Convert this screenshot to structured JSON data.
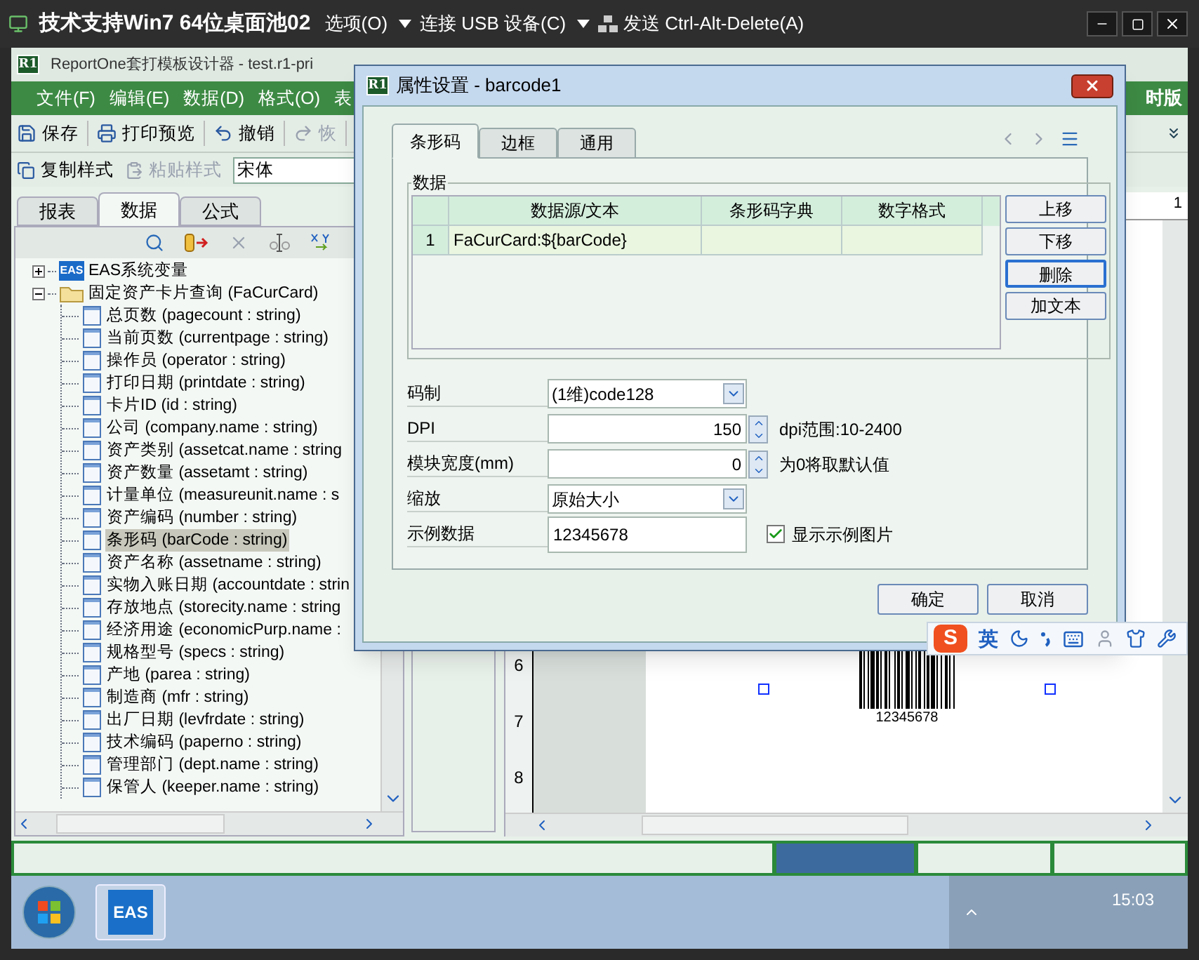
{
  "host_bar": {
    "title": "技术支持Win7 64位桌面池02",
    "menus": [
      {
        "label": "选项(O)",
        "kind": "menu"
      },
      {
        "label": "连接 USB 设备(C)",
        "kind": "menu"
      },
      {
        "label": "发送 Ctrl-Alt-Delete(A)",
        "kind": "action"
      }
    ]
  },
  "app_window": {
    "logo": "R1",
    "title": "ReportOne套打模板设计器 - test.r1-pri"
  },
  "menu_bar": {
    "items": [
      "文件(F)",
      "编辑(E)",
      "数据(D)",
      "格式(O)",
      "表"
    ],
    "right_text": "时版"
  },
  "toolbar": [
    {
      "label": "保存",
      "kind": "save",
      "disabled": false
    },
    {
      "label": "打印预览",
      "kind": "preview",
      "disabled": false
    },
    {
      "label": "撤销",
      "kind": "undo",
      "disabled": false
    },
    {
      "label": "恢",
      "kind": "redo",
      "disabled": true
    }
  ],
  "format_toolbar": {
    "buttons": [
      {
        "label": "复制样式",
        "disabled": false
      },
      {
        "label": "粘贴样式",
        "disabled": true
      }
    ],
    "font": "宋体"
  },
  "left_panel": {
    "tabs": [
      {
        "label": "报表",
        "selected": false
      },
      {
        "label": "数据",
        "selected": true
      },
      {
        "label": "公式",
        "selected": false
      }
    ],
    "tree": [
      {
        "label": "EAS系统变量",
        "logo": "EAS",
        "expanded": false,
        "selected": false
      },
      {
        "label": "固定资产卡片查询 (FaCurCard)",
        "expanded": true,
        "selected": false,
        "children": [
          {
            "label": "总页数 (pagecount : string)",
            "selected": false
          },
          {
            "label": "当前页数 (currentpage : string)",
            "selected": false
          },
          {
            "label": "操作员 (operator : string)",
            "selected": false
          },
          {
            "label": "打印日期 (printdate : string)",
            "selected": false
          },
          {
            "label": "卡片ID (id : string)",
            "selected": false
          },
          {
            "label": "公司 (company.name : string)",
            "selected": false
          },
          {
            "label": "资产类别 (assetcat.name : string",
            "selected": false
          },
          {
            "label": "资产数量 (assetamt : string)",
            "selected": false
          },
          {
            "label": "计量单位 (measureunit.name : s",
            "selected": false
          },
          {
            "label": "资产编码 (number : string)",
            "selected": false
          },
          {
            "label": "条形码 (barCode : string)",
            "selected": true
          },
          {
            "label": "资产名称 (assetname : string)",
            "selected": false
          },
          {
            "label": "实物入账日期 (accountdate : strin",
            "selected": false
          },
          {
            "label": "存放地点 (storecity.name : string",
            "selected": false
          },
          {
            "label": "经济用途 (economicPurp.name :",
            "selected": false
          },
          {
            "label": "规格型号 (specs : string)",
            "selected": false
          },
          {
            "label": "产地 (parea : string)",
            "selected": false
          },
          {
            "label": "制造商 (mfr : string)",
            "selected": false
          },
          {
            "label": "出厂日期 (levfrdate : string)",
            "selected": false
          },
          {
            "label": "技术编码 (paperno : string)",
            "selected": false
          },
          {
            "label": "管理部门 (dept.name : string)",
            "selected": false
          },
          {
            "label": "保管人 (keeper.name : string)",
            "selected": false
          }
        ]
      }
    ]
  },
  "canvas": {
    "ruler_marks": [
      "6",
      "7",
      "8"
    ],
    "top_ruler_mark": "1",
    "barcode_text": "12345678"
  },
  "status_bar": {
    "segments": [
      {
        "selected": false
      },
      {
        "selected": true
      },
      {
        "selected": false
      },
      {
        "selected": false
      }
    ]
  },
  "taskbar": {
    "apps": [
      {
        "label": "EAS",
        "selected": true
      }
    ],
    "clock": "15:03"
  },
  "dialog": {
    "logo": "R1",
    "title": "属性设置 - barcode1",
    "tabs": [
      {
        "label": "条形码",
        "selected": true
      },
      {
        "label": "边框",
        "selected": false
      },
      {
        "label": "通用",
        "selected": false
      }
    ],
    "data_group": {
      "title": "数据",
      "columns": [
        "数据源/文本",
        "条形码字典",
        "数字格式"
      ],
      "rows": [
        {
          "number": "1",
          "cells": [
            "FaCurCard:${barCode}"
          ],
          "selected": true
        }
      ],
      "buttons": [
        {
          "label": "上移",
          "focused": false
        },
        {
          "label": "下移",
          "focused": false
        },
        {
          "label": "删除",
          "focused": true
        },
        {
          "label": "加文本",
          "focused": false
        }
      ]
    },
    "fields": [
      {
        "label": "码制",
        "kind": "select",
        "value": "(1维)code128"
      },
      {
        "label": "DPI",
        "kind": "spinner",
        "value": "150",
        "note": "dpi范围:10-2400"
      },
      {
        "label": "模块宽度(mm)",
        "kind": "spinner",
        "value": "0",
        "note": "为0将取默认值"
      },
      {
        "label": "缩放",
        "kind": "select",
        "value": "原始大小"
      },
      {
        "label": "示例数据",
        "kind": "text",
        "value": "12345678",
        "checkbox": {
          "label": "显示示例图片",
          "checked": true
        }
      }
    ],
    "buttons": [
      "确定",
      "取消"
    ]
  },
  "ime_bar": {
    "logo": "S",
    "mode": "英"
  }
}
